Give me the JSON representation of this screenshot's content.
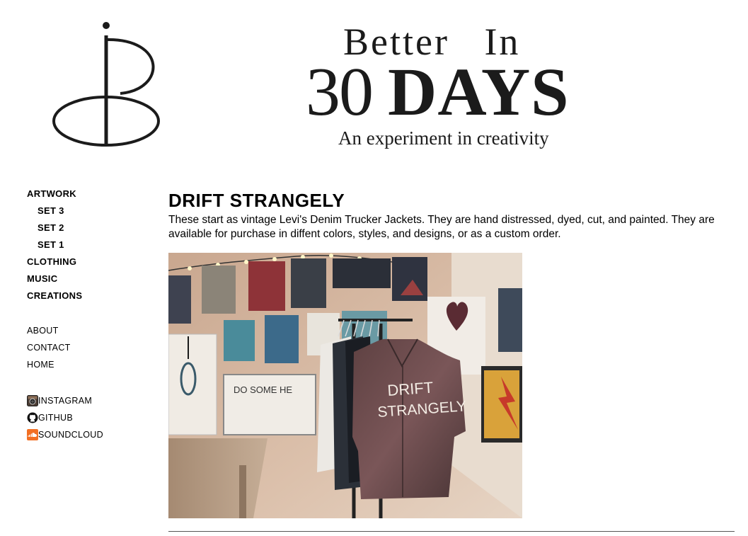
{
  "header": {
    "banner_line1": "Better   In",
    "banner_num": "30",
    "banner_days": "DAYS",
    "tagline": "An experiment in creativity"
  },
  "sidebar": {
    "items": [
      {
        "label": "ARTWORK"
      },
      {
        "label": "SET 3"
      },
      {
        "label": "SET 2"
      },
      {
        "label": "SET 1"
      },
      {
        "label": "CLOTHING"
      },
      {
        "label": "MUSIC"
      },
      {
        "label": "CREATIONS"
      }
    ],
    "pages": [
      {
        "label": "ABOUT"
      },
      {
        "label": "CONTACT"
      },
      {
        "label": "HOME"
      }
    ],
    "social": [
      {
        "label": "INSTAGRAM",
        "icon": "instagram-icon"
      },
      {
        "label": "GITHUB",
        "icon": "github-icon"
      },
      {
        "label": "SOUNDCLOUD",
        "icon": "soundcloud-icon"
      }
    ]
  },
  "main": {
    "title": "DRIFT STRANGELY",
    "description": "These start as vintage Levi's Denim Trucker Jackets. They are hand distressed, dyed, cut, and painted. They are available for purchase in diffent colors, styles, and designs, or as a custom order.",
    "photo_alt": "Drift Strangely vest on clothing rack",
    "vest_text_1": "DRIFT",
    "vest_text_2": "STRANGELY",
    "board_text": "DO SOME HE"
  },
  "colors": {
    "text": "#000000",
    "banner": "#1b1b1b",
    "soundcloud": "#f26f23",
    "rule": "#555555"
  }
}
